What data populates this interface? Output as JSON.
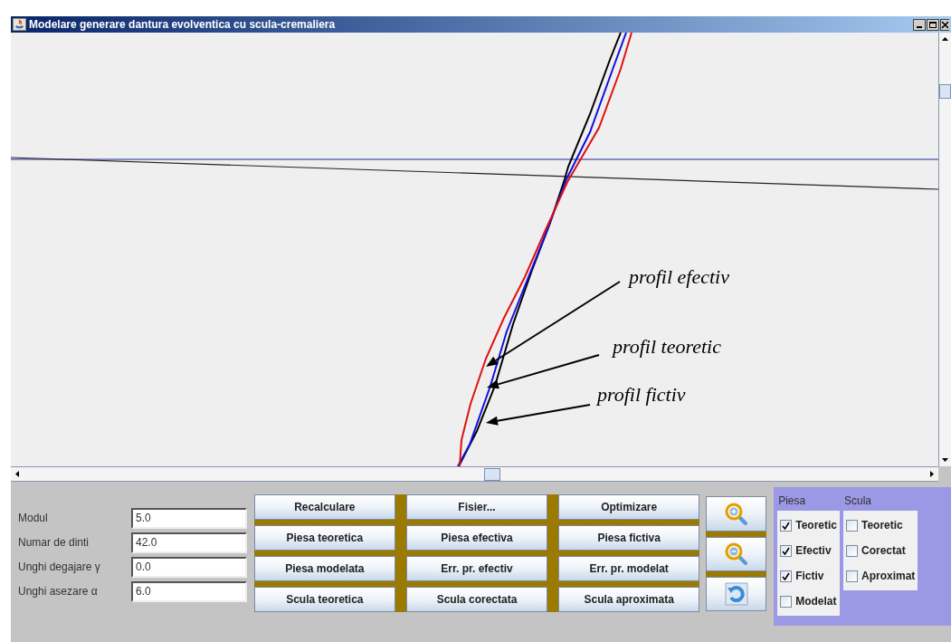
{
  "window": {
    "title": "Modelare generare dantura evolventica cu scula-cremaliera"
  },
  "canvas": {
    "annotations": [
      {
        "text": "profil efectiv"
      },
      {
        "text": "profil teoretic"
      },
      {
        "text": "profil fictiv"
      }
    ]
  },
  "params": [
    {
      "label": "Modul",
      "value": "5.0"
    },
    {
      "label": "Numar de dinti",
      "value": "42.0"
    },
    {
      "label": "Unghi degajare γ",
      "value": "0.0"
    },
    {
      "label": "Unghi asezare α",
      "value": "6.0"
    }
  ],
  "buttons": [
    "Recalculare",
    "Fisier...",
    "Optimizare",
    "Piesa teoretica",
    "Piesa efectiva",
    "Piesa fictiva",
    "Piesa modelata",
    "Err. pr. efectiv",
    "Err. pr. modelat",
    "Scula teoretica",
    "Scula corectata",
    "Scula aproximata"
  ],
  "check_groups": [
    {
      "title": "Piesa",
      "items": [
        {
          "label": "Teoretic",
          "checked": true
        },
        {
          "label": "Efectiv",
          "checked": true
        },
        {
          "label": "Fictiv",
          "checked": true
        },
        {
          "label": "Modelat",
          "checked": false
        }
      ]
    },
    {
      "title": "Scula",
      "items": [
        {
          "label": "Teoretic",
          "checked": false
        },
        {
          "label": "Corectat",
          "checked": false
        },
        {
          "label": "Aproximat",
          "checked": false
        }
      ]
    }
  ]
}
